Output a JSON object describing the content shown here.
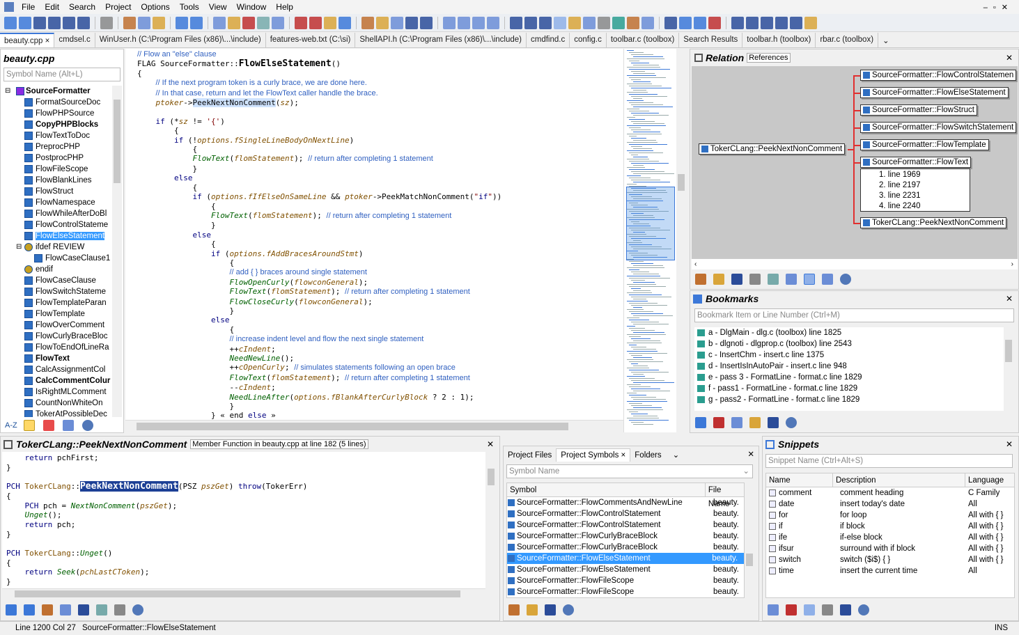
{
  "menu": [
    "File",
    "Edit",
    "Search",
    "Project",
    "Options",
    "Tools",
    "View",
    "Window",
    "Help"
  ],
  "tabs": [
    "beauty.cpp ×",
    "cmdsel.c",
    "WinUser.h (C:\\Program Files (x86)\\...\\include)",
    "features-web.txt (C:\\si)",
    "ShellAPI.h (C:\\Program Files (x86)\\...\\include)",
    "cmdfind.c",
    "config.c",
    "toolbar.c (toolbox)",
    "Search Results",
    "toolbar.h (toolbox)",
    "rbar.c (toolbox)"
  ],
  "symwin": {
    "title": "beauty.cpp",
    "placeholder": "Symbol Name (Alt+L)",
    "items": [
      "SourceFormatter",
      "FormatSourceDoc",
      "FlowPHPSource",
      "CopyPHPBlocks",
      "FlowTextToDoc",
      "PreprocPHP",
      "PostprocPHP",
      "FlowFileScope",
      "FlowBlankLines",
      "FlowStruct",
      "FlowNamespace",
      "FlowWhileAfterDoBl",
      "FlowControlStateme",
      "FlowElseStatement",
      "ifdef REVIEW",
      "FlowCaseClause1",
      "endif",
      "FlowCaseClause",
      "FlowSwitchStateme",
      "FlowTemplateParan",
      "FlowTemplate",
      "FlowOverComment",
      "FlowCurlyBraceBloc",
      "FlowToEndOfLineRa",
      "FlowText",
      "CalcAssignmentCol",
      "CalcCommentColur",
      "IsRightMLComment",
      "CountNonWhiteOn",
      "TokerAtPossibleDec"
    ],
    "az": "A-Z"
  },
  "editor": {
    "lines": [
      "// Flow an \"else\" clause",
      "FLAG SourceFormatter::FlowElseStatement()",
      "{",
      "    // If the next program token is a curly brace, we are done here.",
      "    // In that case, return and let the FlowText caller handle the brace.",
      "    ptoker->PeekNextNonComment(sz);",
      "",
      "    if (*sz != '{')",
      "        {",
      "        if (!options.fSingleLineBodyOnNextLine)",
      "            {",
      "            FlowText(flomStatement); // return after completing 1 statement",
      "            }",
      "        else",
      "            {",
      "            if (options.fIfElseOnSameLine && ptoker->PeekMatchNonComment(\"if\"))",
      "                {",
      "                FlowText(flomStatement); // return after completing 1 statement",
      "                }",
      "            else",
      "                {",
      "                if (options.fAddBracesAroundStmt)",
      "                    {",
      "                    // add { } braces around single statement",
      "                    FlowOpenCurly(flowconGeneral);",
      "                    FlowText(flomStatement); // return after completing 1 statement",
      "                    FlowCloseCurly(flowconGeneral);",
      "                    }",
      "                else",
      "                    {",
      "                    // increase indent level and flow the next single statement",
      "                    ++cIndent;",
      "                    NeedNewLine();",
      "                    ++cOpenCurly; // simulates statements following an open brace",
      "                    FlowText(flomStatement); // return after completing 1 statement",
      "                    --cIndent;",
      "                    NeedLineAfter(options.fBlankAfterCurlyBlock ? 2 : 1);",
      "                    }",
      "                } « end else »"
    ]
  },
  "relation": {
    "title": "Relation",
    "tab": "References",
    "root": "TokerCLang::PeekNextNonComment",
    "nodes": [
      "SourceFormatter::FlowControlStatemen",
      "SourceFormatter::FlowElseStatement",
      "SourceFormatter::FlowStruct",
      "SourceFormatter::FlowSwitchStatement",
      "SourceFormatter::FlowTemplate",
      "SourceFormatter::FlowText",
      "TokerCLang::PeekNextNonComment"
    ],
    "lines": [
      "1. line 1969",
      "2. line 2197",
      "3. line 2231",
      "4. line 2240"
    ]
  },
  "bookmarks": {
    "title": "Bookmarks",
    "placeholder": "Bookmark Item or Line Number (Ctrl+M)",
    "items": [
      "a - DlgMain - dlg.c (toolbox) line 1825",
      "b - dlgnoti - dlgprop.c (toolbox) line 2543",
      "c - InsertChm - insert.c line 1375",
      "d - InsertIsInAutoPair - insert.c line 948",
      "e - pass 3 - FormatLine - format.c line 1829",
      "f - pass1 - FormatLine - format.c line 1829",
      "g - pass2 - FormatLine - format.c line 1829"
    ]
  },
  "context": {
    "title": "TokerCLang::PeekNextNonComment",
    "subtitle": "Member Function in beauty.cpp at line 182 (5 lines)",
    "lines": [
      "    return pchFirst;",
      "}",
      "",
      "PCH TokerCLang::PeekNextNonComment(PSZ pszGet) throw(TokerErr)",
      "{",
      "    PCH pch = NextNonComment(pszGet);",
      "    Unget();",
      "    return pch;",
      "}",
      "",
      "PCH TokerCLang::Unget()",
      "{",
      "    return Seek(pchLastCToken);",
      "}"
    ]
  },
  "projwin": {
    "tabs": [
      "Project Files",
      "Project Symbols ×",
      "Folders"
    ],
    "placeholder": "Symbol Name",
    "col_symbol": "Symbol",
    "col_file": "File Name",
    "rows": [
      [
        "SourceFormatter::FlowCommentsAndNewLine",
        "beauty."
      ],
      [
        "SourceFormatter::FlowControlStatement",
        "beauty."
      ],
      [
        "SourceFormatter::FlowControlStatement",
        "beauty."
      ],
      [
        "SourceFormatter::FlowCurlyBraceBlock",
        "beauty."
      ],
      [
        "SourceFormatter::FlowCurlyBraceBlock",
        "beauty."
      ],
      [
        "SourceFormatter::FlowElseStatement",
        "beauty."
      ],
      [
        "SourceFormatter::FlowElseStatement",
        "beauty."
      ],
      [
        "SourceFormatter::FlowFileScope",
        "beauty."
      ],
      [
        "SourceFormatter::FlowFileScope",
        "beauty."
      ]
    ],
    "selected": 5
  },
  "snippets": {
    "title": "Snippets",
    "placeholder": "Snippet Name (Ctrl+Alt+S)",
    "cols": [
      "Name",
      "Description",
      "Language"
    ],
    "rows": [
      [
        "comment",
        "comment heading",
        "C Family"
      ],
      [
        "date",
        "insert today's date",
        "All"
      ],
      [
        "for",
        "for loop",
        "All with { }"
      ],
      [
        "if",
        "if block",
        "All with { }"
      ],
      [
        "ife",
        "if-else block",
        "All with { }"
      ],
      [
        "ifsur",
        "surround with if block",
        "All with { }"
      ],
      [
        "switch",
        "switch ($i$) { }",
        "All with { }"
      ],
      [
        "time",
        "insert the current time",
        "All"
      ]
    ]
  },
  "status": {
    "pos": "Line 1200  Col 27",
    "sym": "SourceFormatter::FlowElseStatement",
    "mode": "INS"
  }
}
